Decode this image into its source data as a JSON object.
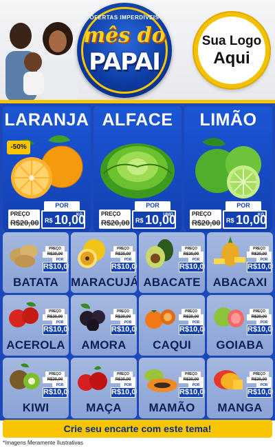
{
  "header": {
    "badge_top": "OFERTAS IMPERDÍVEIS",
    "badge_line1": "mês do",
    "badge_line2": "PAPAI",
    "logo_line1": "Sua Logo",
    "logo_line2": "Aqui"
  },
  "colors": {
    "brand_blue": "#1d49b8",
    "accent_yellow": "#f7c600",
    "header_bg": "#eceef1"
  },
  "featured": [
    {
      "name": "LARANJA",
      "preco_label": "PREÇO",
      "old": "R$20,00",
      "por_label": "POR",
      "rs": "R$",
      "new": "10,00",
      "unit": "KG",
      "discount": "-50%"
    },
    {
      "name": "ALFACE",
      "preco_label": "PREÇO",
      "old": "R$20,00",
      "por_label": "POR",
      "rs": "R$",
      "new": "10,00",
      "unit": "UNID"
    },
    {
      "name": "LIMÃO",
      "preco_label": "PREÇO",
      "old": "R$20,00",
      "por_label": "POR",
      "rs": "R$",
      "new": "10,00",
      "unit": "KG"
    }
  ],
  "products": [
    {
      "name": "BATATA",
      "icon": "potato"
    },
    {
      "name": "MARACUJÁ",
      "icon": "passion-fruit"
    },
    {
      "name": "ABACATE",
      "icon": "avocado"
    },
    {
      "name": "ABACAXI",
      "icon": "pineapple"
    },
    {
      "name": "ACEROLA",
      "icon": "acerola"
    },
    {
      "name": "AMORA",
      "icon": "blackberry"
    },
    {
      "name": "CAQUI",
      "icon": "persimmon"
    },
    {
      "name": "GOIABA",
      "icon": "guava"
    },
    {
      "name": "KIWI",
      "icon": "kiwi"
    },
    {
      "name": "MAÇA",
      "icon": "apple"
    },
    {
      "name": "MAMÃO",
      "icon": "papaya"
    },
    {
      "name": "MANGA",
      "icon": "mango"
    }
  ],
  "small_price": {
    "preco_label": "PREÇO",
    "old": "R$20,00",
    "por_label": "POR",
    "new": "R$10,00",
    "unit": "KG"
  },
  "footer": {
    "cta": "Crie seu encarte com este tema!",
    "note": "*Imagens Meramente Ilustrativas"
  }
}
